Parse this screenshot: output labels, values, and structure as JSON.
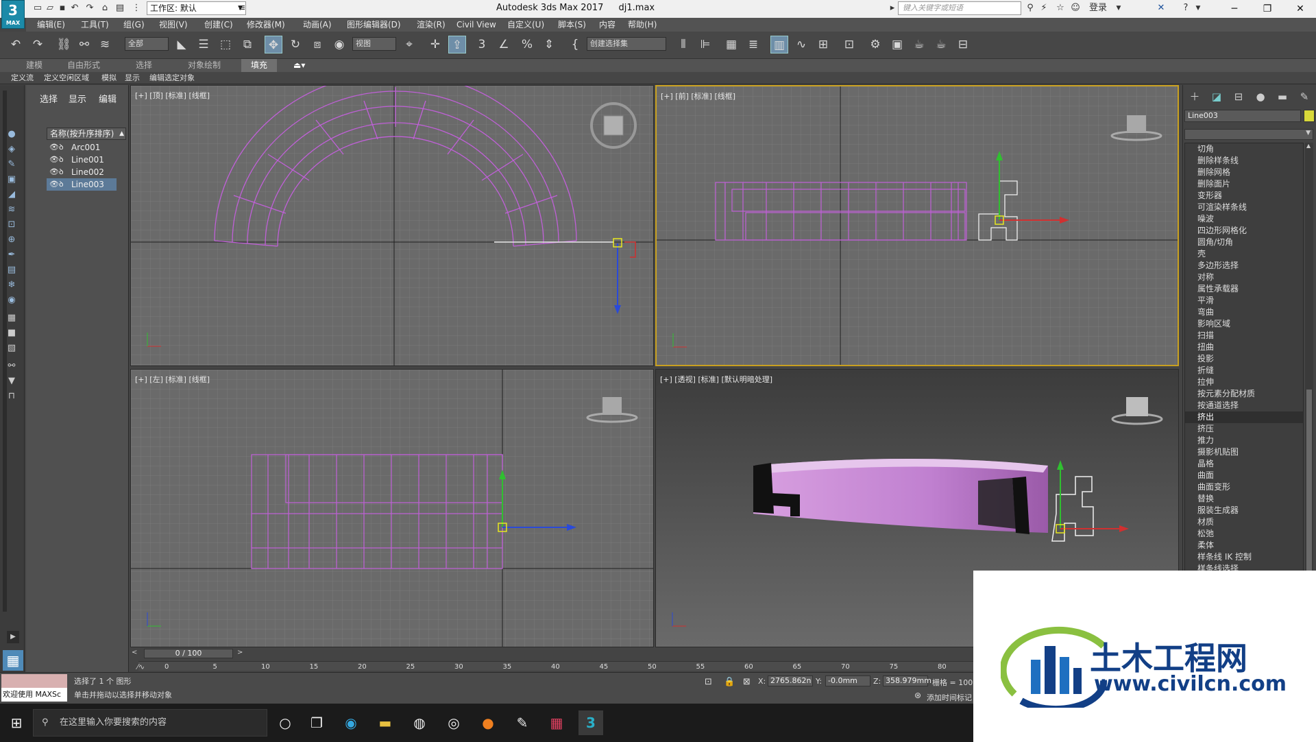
{
  "titlebar": {
    "workspace": "工作区: 默认",
    "app_title": "Autodesk 3ds Max 2017",
    "file_name": "dj1.max",
    "search_placeholder": "键入关键字或短语",
    "login": "登录",
    "logo_text": "3",
    "logo_sub": "MAX"
  },
  "menu": [
    "编辑(E)",
    "工具(T)",
    "组(G)",
    "视图(V)",
    "创建(C)",
    "修改器(M)",
    "动画(A)",
    "图形编辑器(D)",
    "渲染(R)",
    "Civil View",
    "自定义(U)",
    "脚本(S)",
    "内容",
    "帮助(H)"
  ],
  "toolbar": {
    "filter": "全部",
    "refcoord": "视图",
    "selection_set": "创建选择集"
  },
  "ribbon": {
    "tabs": [
      "建模",
      "自由形式",
      "选择",
      "对象绘制",
      "填充"
    ],
    "active_tab": "填充",
    "sub_tabs": [
      "定义流",
      "定义空闲区域",
      "模拟",
      "显示",
      "编辑选定对象"
    ]
  },
  "scene_explorer": {
    "tabs": [
      "选择",
      "显示",
      "编辑"
    ],
    "header": "名称(按升序排序)",
    "objects": [
      "Arc001",
      "Line001",
      "Line002",
      "Line003"
    ],
    "selected": "Line003"
  },
  "viewports": {
    "top": "[+] [顶] [标准] [线框]",
    "front": "[+] [前] [标准] [线框]",
    "left": "[+] [左] [标准] [线框]",
    "persp": "[+] [透视] [标准] [默认明暗处理]"
  },
  "command_panel": {
    "object_name": "Line003",
    "object_color": "#d8d83a",
    "modifiers": [
      "切角",
      "删除样条线",
      "删除网格",
      "删除面片",
      "变形器",
      "可渲染样条线",
      "噪波",
      "四边形网格化",
      "圆角/切角",
      "壳",
      "多边形选择",
      "对称",
      "属性承载器",
      "平滑",
      "弯曲",
      "影响区域",
      "扫描",
      "扭曲",
      "投影",
      "折缝",
      "拉伸",
      "按元素分配材质",
      "按通道选择",
      "挤出",
      "挤压",
      "推力",
      "摄影机贴图",
      "晶格",
      "曲面",
      "曲面变形",
      "替换",
      "服装生成器",
      "材质",
      "松弛",
      "柔体",
      "样条线 IK 控制",
      "样条线选择"
    ],
    "selected_modifier": "挤出"
  },
  "timeline": {
    "frame": "0 / 100",
    "ticks": [
      "0",
      "5",
      "10",
      "15",
      "20",
      "25",
      "30",
      "35",
      "40",
      "45",
      "50",
      "55",
      "60",
      "65",
      "70",
      "75",
      "80"
    ]
  },
  "statusbar": {
    "maxscript": "欢迎使用 MAXSc",
    "status": "选择了 1 个 图形",
    "prompt": "单击并拖动以选择并移动对象",
    "x_label": "X:",
    "x": "2765.862n",
    "y_label": "Y:",
    "y": "-0.0mm",
    "z_label": "Z:",
    "z": "358.979mm",
    "grid": "栅格 = 100.0",
    "add_time_tag": "添加时间标记"
  },
  "taskbar": {
    "search_placeholder": "在这里输入你要搜索的内容"
  },
  "watermark": {
    "name": "土木工程网",
    "url": "www.civilcn.com",
    "color": "#123f86"
  }
}
